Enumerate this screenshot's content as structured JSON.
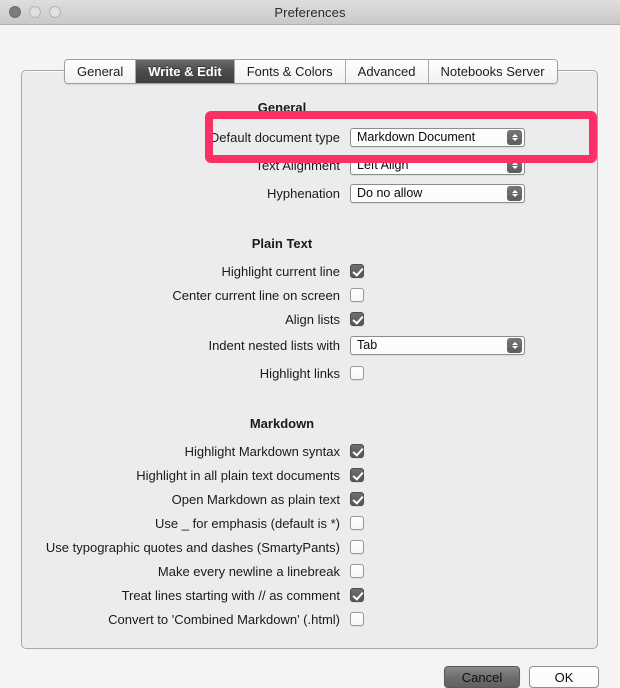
{
  "window": {
    "title": "Preferences",
    "traffic_lights": [
      "close-button",
      "minimize-button",
      "maximize-button"
    ]
  },
  "tabs": [
    {
      "label": "General",
      "selected": false
    },
    {
      "label": "Write & Edit",
      "selected": true
    },
    {
      "label": "Fonts & Colors",
      "selected": false
    },
    {
      "label": "Advanced",
      "selected": false
    },
    {
      "label": "Notebooks Server",
      "selected": false
    }
  ],
  "sections": {
    "general": {
      "heading": "General",
      "rows": [
        {
          "label": "Default document type",
          "type": "popup",
          "value": "Markdown Document"
        },
        {
          "label": "Text Alignment",
          "type": "popup",
          "value": "Left Align"
        },
        {
          "label": "Hyphenation",
          "type": "popup",
          "value": "Do no allow"
        }
      ]
    },
    "plain_text": {
      "heading": "Plain Text",
      "rows": [
        {
          "label": "Highlight current line",
          "type": "checkbox",
          "checked": true
        },
        {
          "label": "Center current line on screen",
          "type": "checkbox",
          "checked": false
        },
        {
          "label": "Align lists",
          "type": "checkbox",
          "checked": true
        },
        {
          "label": "Indent nested lists with",
          "type": "popup",
          "value": "Tab"
        },
        {
          "label": "Highlight links",
          "type": "checkbox",
          "checked": false
        }
      ]
    },
    "markdown": {
      "heading": "Markdown",
      "rows": [
        {
          "label": "Highlight Markdown syntax",
          "type": "checkbox",
          "checked": true
        },
        {
          "label": "Highlight in all plain text documents",
          "type": "checkbox",
          "checked": true
        },
        {
          "label": "Open Markdown as plain text",
          "type": "checkbox",
          "checked": true
        },
        {
          "label": "Use _ for emphasis (default is *)",
          "type": "checkbox",
          "checked": false
        },
        {
          "label": "Use typographic quotes and dashes (SmartyPants)",
          "type": "checkbox",
          "checked": false
        },
        {
          "label": "Make every newline a linebreak",
          "type": "checkbox",
          "checked": false
        },
        {
          "label": "Treat lines starting with // as comment",
          "type": "checkbox",
          "checked": true
        },
        {
          "label": "Convert to 'Combined Markdown' (.html)",
          "type": "checkbox",
          "checked": false
        }
      ]
    }
  },
  "buttons": {
    "cancel": "Cancel",
    "ok": "OK"
  },
  "annotation": {
    "color": "#fb3065",
    "target": "Default document type"
  }
}
